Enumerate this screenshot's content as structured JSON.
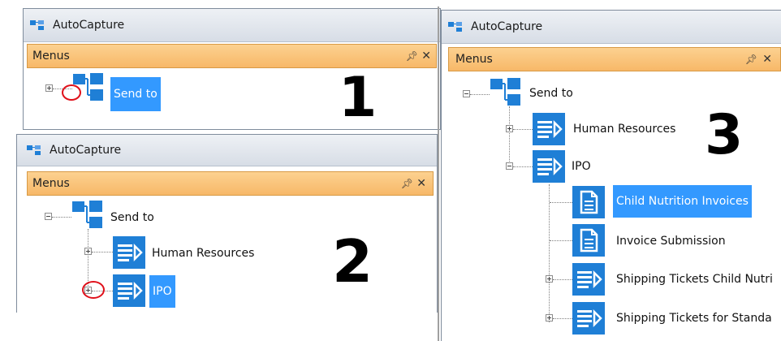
{
  "panel1": {
    "app_title": "AutoCapture",
    "menus_label": "Menus",
    "pin_glyph": "ᵖ",
    "close_glyph": "✕",
    "step_number": "1",
    "tree": {
      "root_label": "Send to"
    }
  },
  "panel2": {
    "app_title": "AutoCapture",
    "menus_label": "Menus",
    "pin_glyph": "ᵖ",
    "close_glyph": "✕",
    "step_number": "2",
    "tree": {
      "root_label": "Send to",
      "children": [
        "Human Resources",
        "IPO"
      ]
    }
  },
  "panel3": {
    "app_title": "AutoCapture",
    "menus_label": "Menus",
    "pin_glyph": "ᵖ",
    "close_glyph": "✕",
    "step_number": "3",
    "tree": {
      "root_label": "Send to",
      "children": [
        "Human Resources",
        "IPO"
      ],
      "ipo_children": [
        "Child Nutrition Invoices",
        "Invoice Submission",
        "Shipping Tickets Child Nutri",
        "Shipping Tickets for Standa"
      ]
    }
  },
  "icons": {
    "tree_root": "org-tree-icon",
    "menu_node": "document-list-arrow-icon",
    "document": "document-icon",
    "app": "app-tree-icon"
  },
  "colors": {
    "menubar": "#f7b868",
    "selection": "#3399ff",
    "icon_blue": "#1f7fd6",
    "highlight_circle": "#e0101a"
  }
}
